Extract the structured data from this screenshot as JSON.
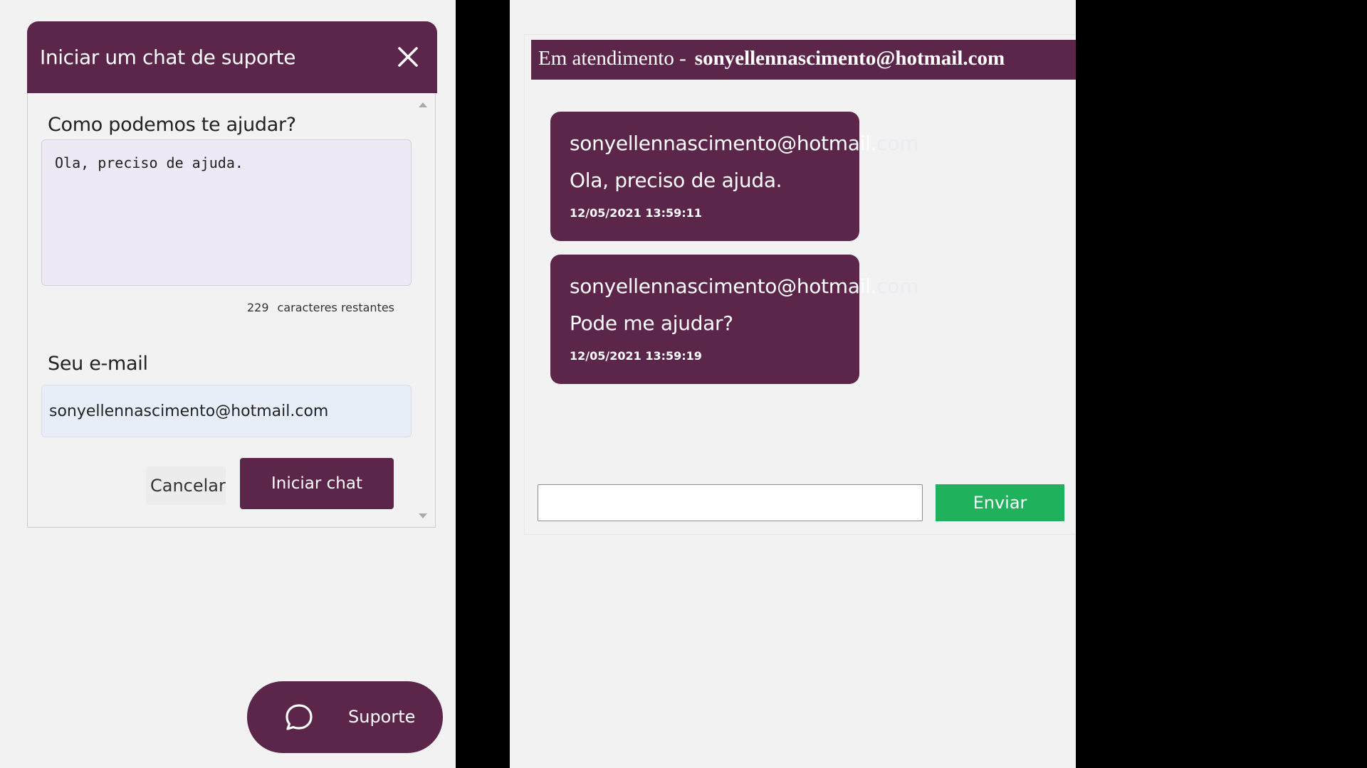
{
  "support_dialog": {
    "title": "Iniciar um chat de suporte",
    "help_label": "Como podemos te ajudar?",
    "message_value": "Ola, preciso de ajuda.",
    "chars_remaining": "229",
    "chars_remaining_label": "caracteres restantes",
    "email_label": "Seu e-mail",
    "email_value": "sonyellennascimento@hotmail.com",
    "cancel_label": "Cancelar",
    "start_label": "Iniciar chat"
  },
  "support_fab": {
    "label": "Suporte",
    "icon": "chat-bubble-icon"
  },
  "agent_chat": {
    "header_prefix": "Em atendimento -",
    "header_user": "sonyellennascimento@hotmail.com",
    "messages": [
      {
        "from_visible": "sonyellennascimento@hotmail.",
        "from_faded": "com",
        "text": "Ola, preciso de ajuda.",
        "time": "12/05/2021 13:59:11"
      },
      {
        "from_visible": "sonyellennascimento@hotmail.",
        "from_faded": "com",
        "text": "Pode me ajudar?",
        "time": "12/05/2021 13:59:19"
      }
    ],
    "input_value": "",
    "send_label": "Enviar"
  },
  "colors": {
    "brand": "#5b2649",
    "send": "#1fb15c",
    "background": "#f2f2f2"
  }
}
